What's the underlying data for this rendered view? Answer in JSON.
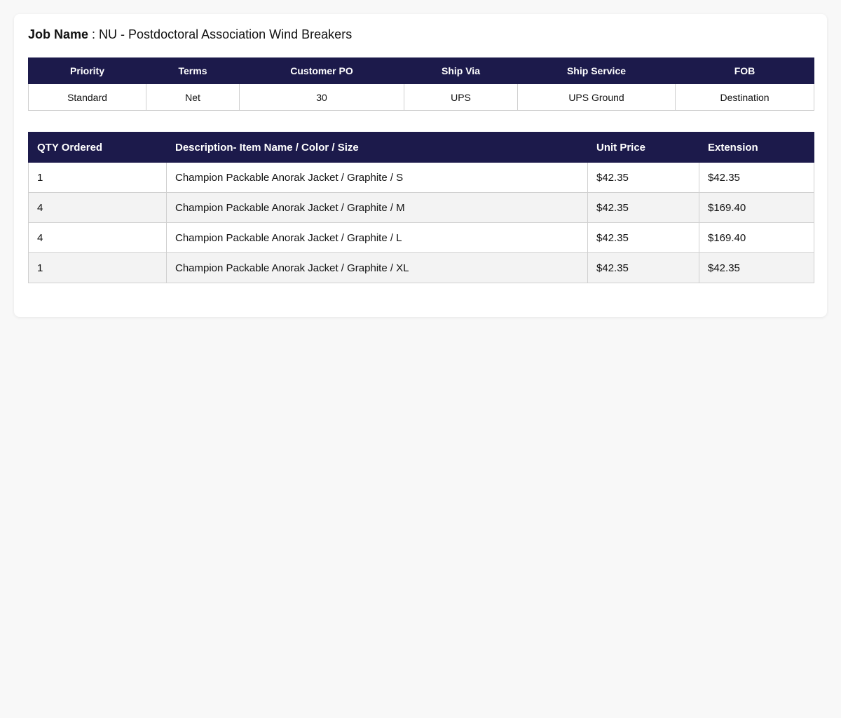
{
  "job": {
    "label": "Job Name",
    "separator": " : ",
    "value": "NU - Postdoctoral Association Wind Breakers"
  },
  "order_info": {
    "headers": [
      "Priority",
      "Terms",
      "Customer PO",
      "Ship Via",
      "Ship Service",
      "FOB"
    ],
    "values": [
      "Standard",
      "Net",
      "30",
      "UPS",
      "UPS Ground",
      "Destination"
    ]
  },
  "items": {
    "headers": [
      "QTY Ordered",
      "Description- Item Name / Color / Size",
      "Unit Price",
      "Extension"
    ],
    "rows": [
      [
        "1",
        "Champion Packable Anorak Jacket / Graphite / S",
        "$42.35",
        "$42.35"
      ],
      [
        "4",
        "Champion Packable Anorak Jacket / Graphite / M",
        "$42.35",
        "$169.40"
      ],
      [
        "4",
        "Champion Packable Anorak Jacket / Graphite / L",
        "$42.35",
        "$169.40"
      ],
      [
        "1",
        "Champion Packable Anorak Jacket / Graphite / XL",
        "$42.35",
        "$42.35"
      ]
    ]
  },
  "colors": {
    "header_bg": "#1c1a4b",
    "page_bg": "#f8f8f8",
    "stripe_bg": "#f3f3f3"
  }
}
